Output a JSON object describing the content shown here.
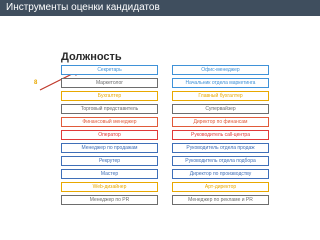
{
  "header": {
    "title": "Инструменты оценки кандидатов"
  },
  "section": {
    "title": "Должность"
  },
  "annotation": {
    "label": "8"
  },
  "positions": [
    {
      "label": "Секретарь",
      "color": "#3f92d8"
    },
    {
      "label": "Офис-менеджер",
      "color": "#3f92d8"
    },
    {
      "label": "Маркетолог",
      "color": "#6d6d6d"
    },
    {
      "label": "Начальник отдела маркетинга",
      "color": "#3f92d8"
    },
    {
      "label": "Бухгалтер",
      "color": "#e8a800"
    },
    {
      "label": "Главный бухгалтер",
      "color": "#e8a800"
    },
    {
      "label": "Торговый представитель",
      "color": "#6d6d6d"
    },
    {
      "label": "Супервайзер",
      "color": "#6d6d6d"
    },
    {
      "label": "Финансовый менеджер",
      "color": "#e05a3a"
    },
    {
      "label": "Директор по финансам",
      "color": "#e05a3a"
    },
    {
      "label": "Оператор",
      "color": "#e03a3a"
    },
    {
      "label": "Руководитель call-центра",
      "color": "#e03a3a"
    },
    {
      "label": "Менеджер по продажам",
      "color": "#3f6fb8"
    },
    {
      "label": "Руководитель отдела продаж",
      "color": "#3f6fb8"
    },
    {
      "label": "Рекрутер",
      "color": "#3f6fb8"
    },
    {
      "label": "Руководитель отдела подбора",
      "color": "#3f6fb8"
    },
    {
      "label": "Мастер",
      "color": "#3f6fb8"
    },
    {
      "label": "Директор по производству",
      "color": "#3f6fb8"
    },
    {
      "label": "Web-дизайнер",
      "color": "#e8a800"
    },
    {
      "label": "Арт-директор",
      "color": "#e8a800"
    },
    {
      "label": "Менеджер по PR",
      "color": "#6d6d6d"
    },
    {
      "label": "Менеджер по рекламе и PR",
      "color": "#6d6d6d"
    }
  ]
}
